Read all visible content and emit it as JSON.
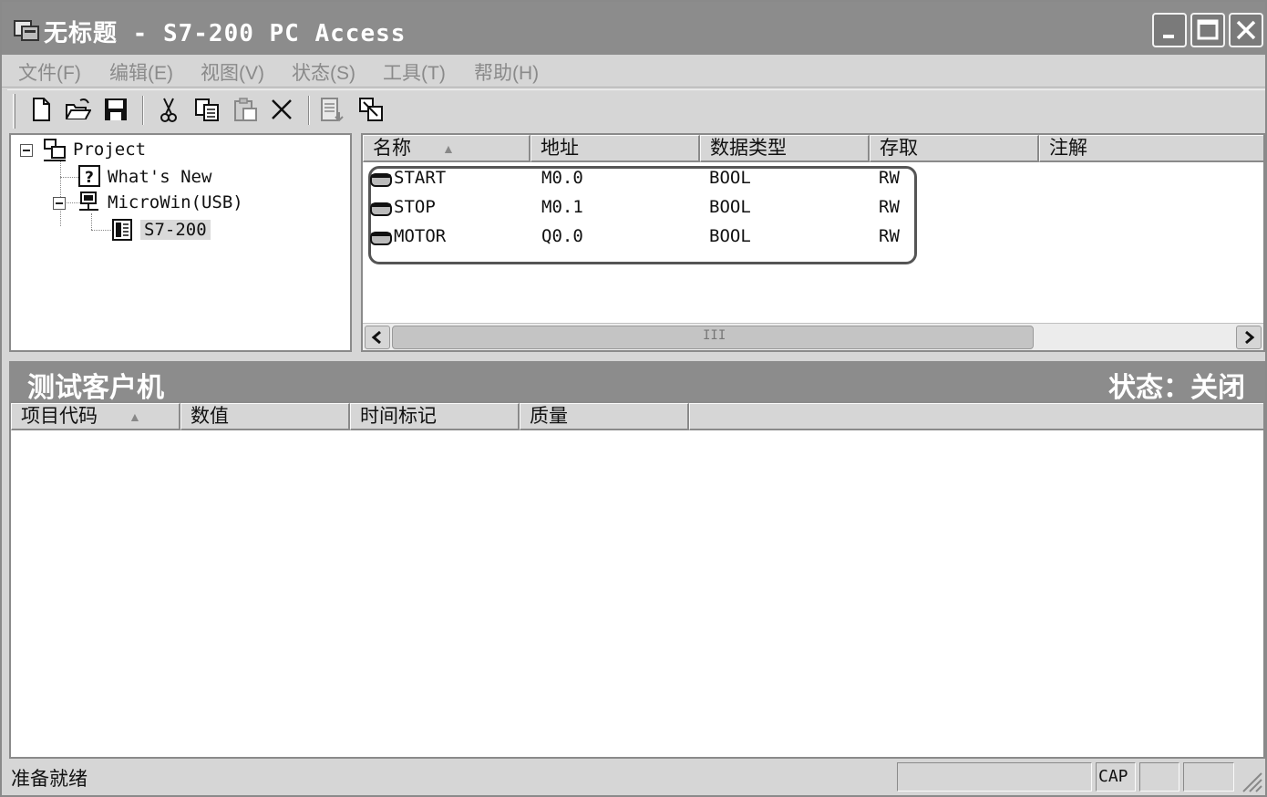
{
  "window": {
    "title": "无标题 - S7-200 PC Access",
    "icon": "app-icon",
    "controls": [
      "minimize",
      "maximize",
      "close"
    ]
  },
  "menubar": {
    "items": [
      "文件(F)",
      "编辑(E)",
      "视图(V)",
      "状态(S)",
      "工具(T)",
      "帮助(H)"
    ]
  },
  "toolbar": {
    "buttons": [
      "new-icon",
      "open-icon",
      "save-icon",
      "cut-icon",
      "copy-icon",
      "paste-icon",
      "delete-icon",
      "add-item-icon",
      "test-client-icon"
    ]
  },
  "tree": {
    "root": "Project",
    "children": [
      {
        "label": "What's New",
        "icon": "help-icon"
      },
      {
        "label": "MicroWin(USB)",
        "icon": "network-icon",
        "children": [
          {
            "label": "S7-200",
            "icon": "plc-icon",
            "selected": true
          }
        ]
      }
    ]
  },
  "items": {
    "columns": [
      "名称",
      "地址",
      "数据类型",
      "存取",
      "注解"
    ],
    "rows": [
      {
        "name": "START",
        "address": "M0.0",
        "type": "BOOL",
        "access": "RW",
        "comment": ""
      },
      {
        "name": "STOP",
        "address": "M0.1",
        "type": "BOOL",
        "access": "RW",
        "comment": ""
      },
      {
        "name": "MOTOR",
        "address": "Q0.0",
        "type": "BOOL",
        "access": "RW",
        "comment": ""
      }
    ],
    "scroll_thumb_label": "III"
  },
  "test_client": {
    "title": "测试客户机",
    "status": "状态：关闭",
    "columns": [
      "项目代码",
      "数值",
      "时间标记",
      "质量"
    ]
  },
  "statusbar": {
    "text": "准备就绪",
    "indicators": [
      "",
      "CAP",
      "",
      ""
    ]
  },
  "colors": {
    "title_bar": "#8c8c8c",
    "panel": "#d6d6d6",
    "content_bg": "#ffffff"
  }
}
